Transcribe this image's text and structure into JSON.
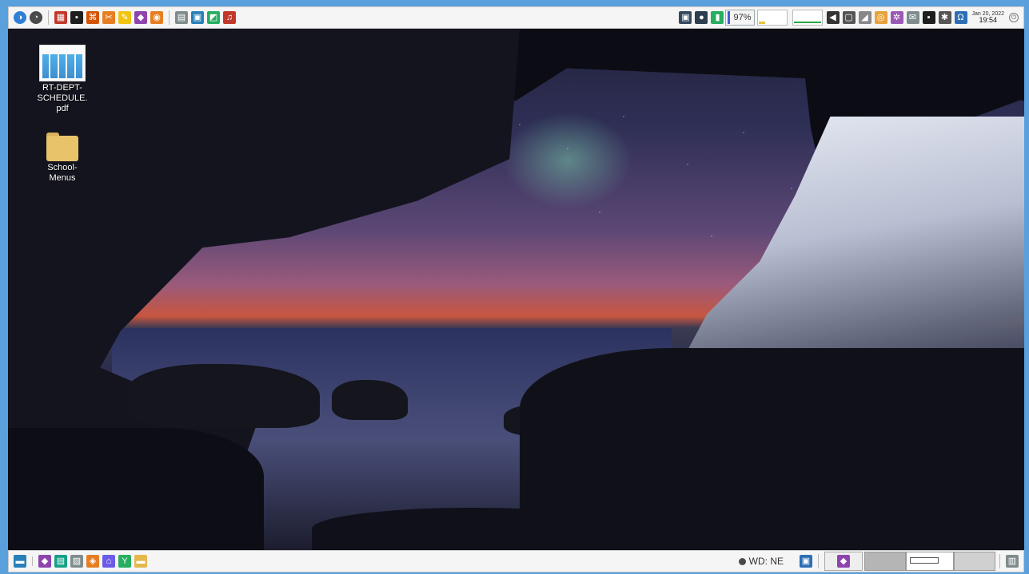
{
  "top_panel": {
    "launchers_left": [
      {
        "name": "start-menu-icon",
        "color": "#2f7fd6",
        "glyph": "◑"
      },
      {
        "name": "clock-app-icon",
        "color": "#4a4a4a",
        "glyph": "◔"
      },
      {
        "name": "system-monitor-icon",
        "color": "#c0392b",
        "glyph": "▦"
      },
      {
        "name": "terminal-icon",
        "color": "#1e1e1e",
        "glyph": "▪"
      },
      {
        "name": "settings-tool-icon",
        "color": "#d35400",
        "glyph": "⌘"
      },
      {
        "name": "tools-icon",
        "color": "#e67e22",
        "glyph": "✂"
      },
      {
        "name": "editor-icon",
        "color": "#f1c40f",
        "glyph": "✎"
      },
      {
        "name": "package-icon",
        "color": "#8e44ad",
        "glyph": "◆"
      },
      {
        "name": "chat-icon",
        "color": "#e67e22",
        "glyph": "◉"
      }
    ],
    "launchers_middle": [
      {
        "name": "calculator-icon",
        "color": "#7f8c8d",
        "glyph": "▤"
      },
      {
        "name": "image-viewer-icon",
        "color": "#2980b9",
        "glyph": "▣"
      },
      {
        "name": "photos-icon",
        "color": "#27ae60",
        "glyph": "◩"
      },
      {
        "name": "media-player-icon",
        "color": "#c0392b",
        "glyph": "♫"
      }
    ],
    "tray": {
      "battery_percent": "97%",
      "icons": [
        {
          "name": "screen-icon",
          "color": "#34495e",
          "glyph": "▣"
        },
        {
          "name": "network-status-icon",
          "color": "#2c3e50",
          "glyph": "●"
        },
        {
          "name": "battery-icon",
          "color": "#27ae60",
          "glyph": "▮"
        }
      ],
      "icons_after": [
        {
          "name": "volume-icon",
          "color": "#333333",
          "glyph": "◀"
        },
        {
          "name": "clipboard-icon",
          "color": "#555555",
          "glyph": "▢"
        },
        {
          "name": "wifi-signal-icon",
          "color": "#888888",
          "glyph": "◢"
        },
        {
          "name": "updates-icon",
          "color": "#e6a23c",
          "glyph": "◎"
        },
        {
          "name": "network-icon",
          "color": "#9b59b6",
          "glyph": "✲"
        },
        {
          "name": "mail-icon",
          "color": "#7f8c8d",
          "glyph": "✉"
        },
        {
          "name": "terminal-tray-icon",
          "color": "#1e1e1e",
          "glyph": "▪"
        },
        {
          "name": "bluetooth-icon",
          "color": "#555555",
          "glyph": "✱"
        },
        {
          "name": "unicode-char-icon",
          "color": "#2c6fb5",
          "glyph": "Ω"
        }
      ]
    },
    "clock": {
      "date": "Jan 20, 2022",
      "time": "19:54"
    }
  },
  "desktop": {
    "icons": [
      {
        "label_line1": "RT-DEPT-",
        "label_line2": "SCHEDULE.",
        "label_line3": "pdf"
      },
      {
        "label_line1": "School-",
        "label_line2": "Menus"
      }
    ]
  },
  "bottom_panel": {
    "launchers": [
      {
        "name": "show-desktop-icon",
        "color": "#2980b9",
        "glyph": "▬"
      },
      {
        "name": "file-manager-icon",
        "color": "#8e44ad",
        "glyph": "◆"
      },
      {
        "name": "notes-icon",
        "color": "#16a085",
        "glyph": "▤"
      },
      {
        "name": "text-editor-icon",
        "color": "#7f8c8d",
        "glyph": "▨"
      },
      {
        "name": "shield-icon",
        "color": "#e67e22",
        "glyph": "◈"
      },
      {
        "name": "app-launcher-icon",
        "color": "#6c5ce7",
        "glyph": "⌂"
      },
      {
        "name": "software-manager-icon",
        "color": "#27ae60",
        "glyph": "Y"
      },
      {
        "name": "folder-shortcut-icon",
        "color": "#e6b84a",
        "glyph": "▬"
      }
    ],
    "wd_label": "WD: NE"
  }
}
